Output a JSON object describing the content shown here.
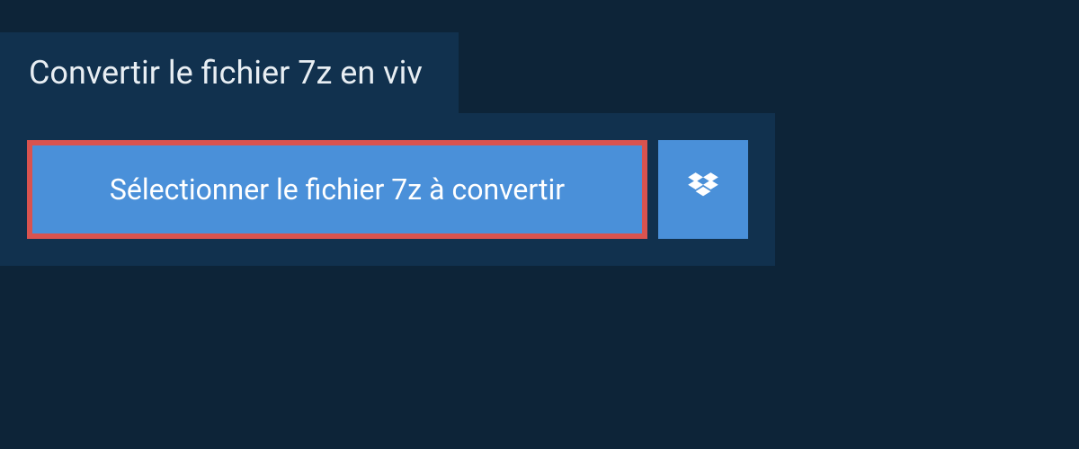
{
  "header": {
    "title": "Convertir le fichier 7z en viv"
  },
  "buttons": {
    "select_file_label": "Sélectionner le fichier 7z à convertir"
  },
  "colors": {
    "background": "#0d2438",
    "panel": "#11314e",
    "button": "#4a90d9",
    "highlight_border": "#d9534f",
    "text": "#ffffff"
  }
}
